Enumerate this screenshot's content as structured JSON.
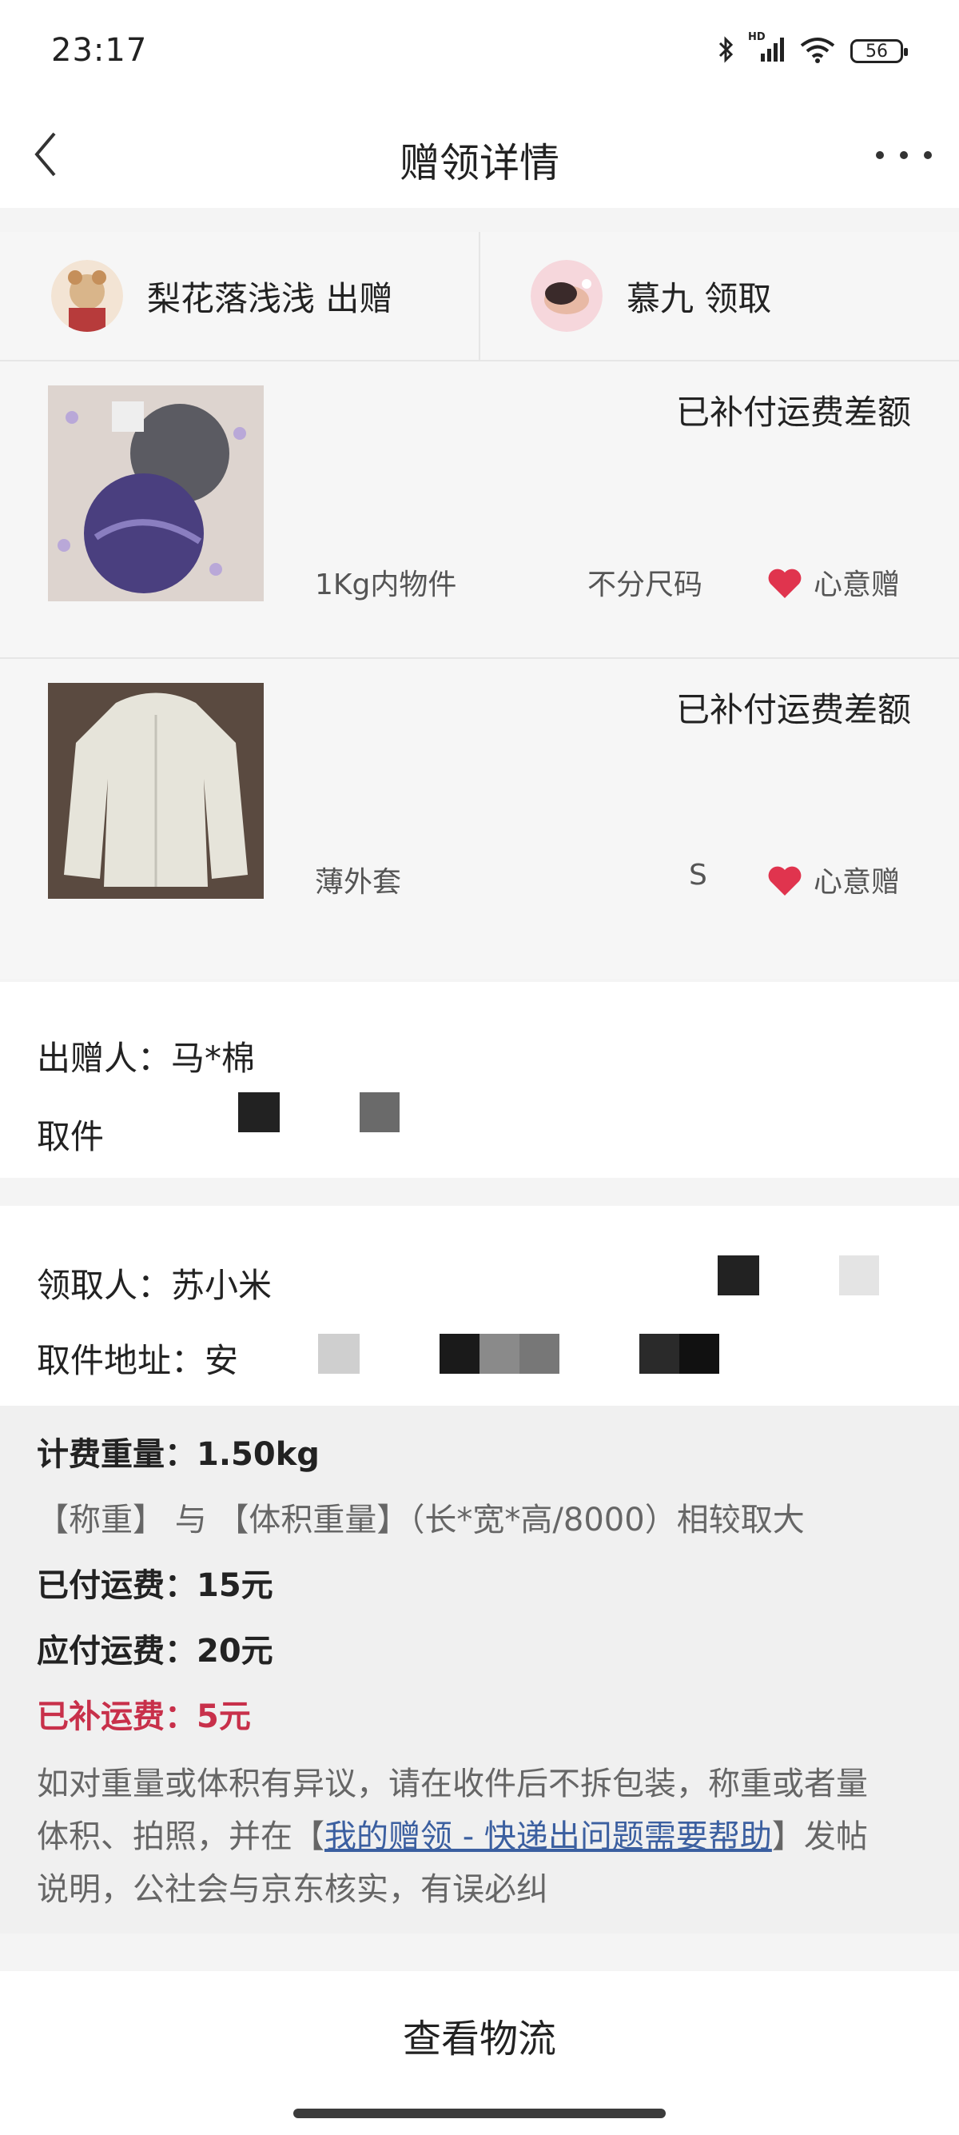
{
  "status_bar": {
    "time": "23:17",
    "battery": "56",
    "network": "HD"
  },
  "nav": {
    "title": "赠领详情"
  },
  "giver_user": {
    "name": "梨花落浅浅 出赠"
  },
  "receiver_user": {
    "name": "慕九 领取"
  },
  "items": [
    {
      "status": "已补付运费差额",
      "name": "1Kg内物件",
      "size": "不分尺码",
      "tag": "心意赠"
    },
    {
      "status": "已补付运费差额",
      "name": "薄外套",
      "size": "S",
      "tag": "心意赠"
    }
  ],
  "sender": {
    "label": "出赠人：",
    "name": "马*棉",
    "address_label": "取件"
  },
  "receiver": {
    "label": "领取人：",
    "name": "苏小米",
    "address_label": "取件地址：",
    "address_start": "安"
  },
  "fee": {
    "weight_label": "计费重量：",
    "weight_value": "1.50kg",
    "note": "【称重】 与 【体积重量】（长*宽*高/8000）相较取大",
    "paid_label": "已付运费：",
    "paid_value": "15元",
    "due_label": "应付运费：",
    "due_value": "20元",
    "supplement_label": "已补运费：",
    "supplement_value": "5元",
    "dispute_line1": "如对重量或体积有异议，请在收件后不拆包装，称重或者量",
    "dispute_line2_a": "体积、拍照，并在【",
    "dispute_link": "我的赠领 - 快递出问题需要帮助",
    "dispute_line2_b": "】发帖",
    "dispute_line3": "说明，公社会与京东核实，有误必纠"
  },
  "bottom": {
    "button_label": "查看物流"
  },
  "colors": {
    "accent_red": "#c8304a",
    "heart": "#e0344e",
    "link": "#3b5fa0"
  }
}
